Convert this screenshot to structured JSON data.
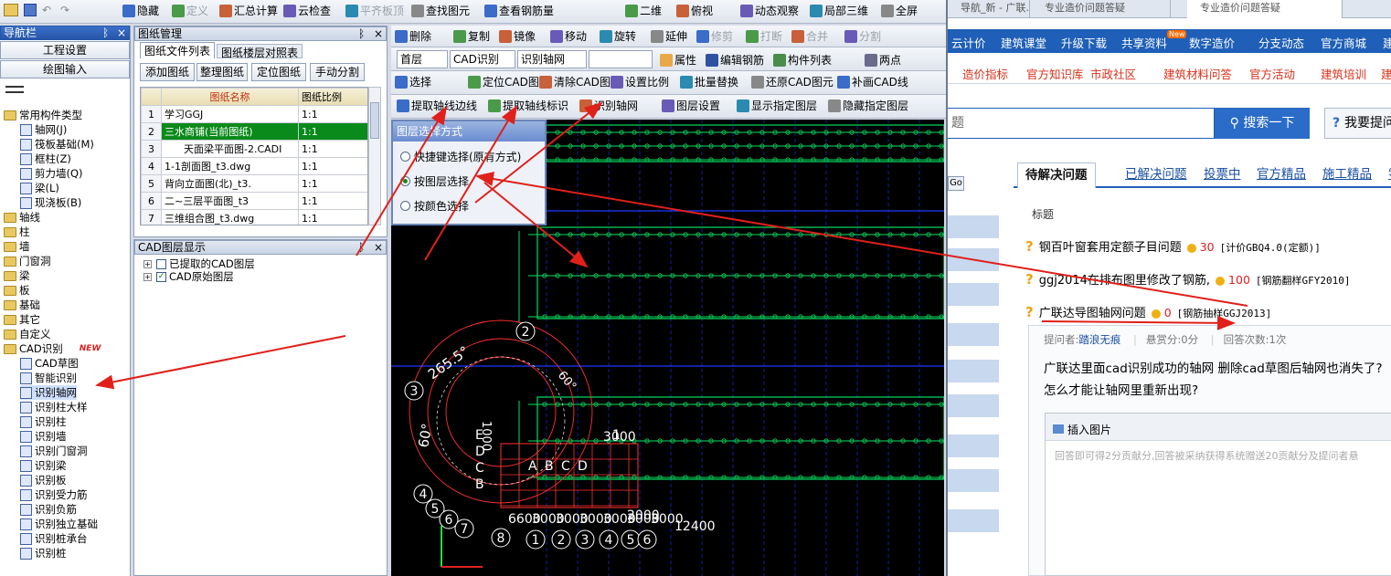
{
  "nav": {
    "title": "导航栏",
    "pin": "ᛒ",
    "close": "×",
    "btn_project": "工程设置",
    "btn_draw": "绘图输入",
    "tree": [
      {
        "label": "常用构件类型",
        "level": 0,
        "kind": "folder"
      },
      {
        "label": "轴网(J)",
        "level": 1,
        "kind": "item"
      },
      {
        "label": "筏板基础(M)",
        "level": 1,
        "kind": "item"
      },
      {
        "label": "框柱(Z)",
        "level": 1,
        "kind": "item"
      },
      {
        "label": "剪力墙(Q)",
        "level": 1,
        "kind": "item"
      },
      {
        "label": "梁(L)",
        "level": 1,
        "kind": "item"
      },
      {
        "label": "现浇板(B)",
        "level": 1,
        "kind": "item"
      },
      {
        "label": "轴线",
        "level": 0,
        "kind": "folder"
      },
      {
        "label": "柱",
        "level": 0,
        "kind": "folder"
      },
      {
        "label": "墙",
        "level": 0,
        "kind": "folder"
      },
      {
        "label": "门窗洞",
        "level": 0,
        "kind": "folder"
      },
      {
        "label": "梁",
        "level": 0,
        "kind": "folder"
      },
      {
        "label": "板",
        "level": 0,
        "kind": "folder"
      },
      {
        "label": "基础",
        "level": 0,
        "kind": "folder"
      },
      {
        "label": "其它",
        "level": 0,
        "kind": "folder"
      },
      {
        "label": "自定义",
        "level": 0,
        "kind": "folder"
      },
      {
        "label": "CAD识别",
        "level": 0,
        "kind": "folder",
        "badge": "NEW"
      },
      {
        "label": "CAD草图",
        "level": 1,
        "kind": "item"
      },
      {
        "label": "智能识别",
        "level": 1,
        "kind": "item"
      },
      {
        "label": "识别轴网",
        "level": 1,
        "kind": "item",
        "selected": true
      },
      {
        "label": "识别柱大样",
        "level": 1,
        "kind": "item"
      },
      {
        "label": "识别柱",
        "level": 1,
        "kind": "item"
      },
      {
        "label": "识别墙",
        "level": 1,
        "kind": "item"
      },
      {
        "label": "识别门窗洞",
        "level": 1,
        "kind": "item"
      },
      {
        "label": "识别梁",
        "level": 1,
        "kind": "item"
      },
      {
        "label": "识别板",
        "level": 1,
        "kind": "item"
      },
      {
        "label": "识别受力筋",
        "level": 1,
        "kind": "item"
      },
      {
        "label": "识别负筋",
        "level": 1,
        "kind": "item"
      },
      {
        "label": "识别独立基础",
        "level": 1,
        "kind": "item"
      },
      {
        "label": "识别桩承台",
        "level": 1,
        "kind": "item"
      },
      {
        "label": "识别桩",
        "level": 1,
        "kind": "item"
      }
    ]
  },
  "toolbar1": [
    "隐藏",
    "定义",
    "汇总计算",
    "云检查",
    "平齐板顶",
    "查找图元",
    "查看钢筋量",
    "二维",
    "俯视",
    "动态观察",
    "局部三维",
    "全屏"
  ],
  "toolbar2": [
    "删除",
    "复制",
    "镜像",
    "移动",
    "旋转",
    "延伸",
    "修剪",
    "打断",
    "合并",
    "分割"
  ],
  "toolbar3": {
    "floor": "首层",
    "cad": "CAD识别",
    "axis": "识别轴网",
    "blank": "",
    "attr": "属性",
    "edit": "编辑钢筋",
    "list": "构件列表",
    "two": "两点"
  },
  "toolbar4": [
    "选择",
    "定位CAD图",
    "清除CAD图",
    "设置比例",
    "批量替换",
    "还原CAD图元",
    "补画CAD线"
  ],
  "toolbar5": [
    "提取轴线边线",
    "提取轴线标识",
    "识别轴网",
    "图层设置",
    "显示指定图层",
    "隐藏指定图层"
  ],
  "drawing_mgr": {
    "title": "图纸管理",
    "tab1": "图纸文件列表",
    "tab2": "图纸楼层对照表",
    "btns": [
      "添加图纸",
      "整理图纸",
      "定位图纸",
      "手动分割"
    ],
    "col_name": "图纸名称",
    "col_ratio": "图纸比例",
    "rows": [
      [
        "1",
        "学习GGJ",
        "1:1"
      ],
      [
        "2",
        "三水商铺(当前图纸)",
        "1:1"
      ],
      [
        "3",
        "天面梁平面图-2.CADI",
        "1:1"
      ],
      [
        "4",
        "1-1剖面图_t3.dwg",
        "1:1"
      ],
      [
        "5",
        "背向立面图(北)_t3.",
        "1:1"
      ],
      [
        "6",
        "二~三层平面图_t3",
        "1:1"
      ],
      [
        "7",
        "三维组合图_t3.dwg",
        "1:1"
      ]
    ]
  },
  "cad_layer": {
    "title": "CAD图层显示",
    "items": [
      "已提取的CAD图层",
      "CAD原始图层"
    ]
  },
  "layer_dialog": {
    "title": "图层选择方式",
    "options": [
      "快捷键选择(原有方式)",
      "按图层选择",
      "按颜色选择"
    ],
    "selected": 1
  },
  "cad_labels": {
    "angle1": "265.5°",
    "angle2": "60°",
    "angle3": "60°",
    "dims": [
      "6600",
      "3000",
      "3000",
      "3000",
      "3000",
      "3000",
      "3000",
      "12400"
    ],
    "letters": [
      "A",
      "B",
      "C",
      "D"
    ],
    "letters_v": [
      "E",
      "D",
      "C",
      "B"
    ],
    "nums": [
      "2",
      "3",
      "4",
      "5",
      "6",
      "7",
      "8",
      "1",
      "2",
      "3",
      "4",
      "5",
      "6",
      "7"
    ],
    "misc": [
      "1000",
      "2000",
      "3000",
      "1"
    ]
  },
  "browser": {
    "tabs": [
      "导航_新 - 广联...",
      "专业造价问题答疑",
      "专业造价问题答疑"
    ],
    "nav": [
      "云计价",
      "建筑课堂",
      "升级下载",
      "共享资料",
      "数字造价",
      "分支动态",
      "官方商城",
      "建筑"
    ],
    "nav_badge": "New",
    "subnav": [
      "造价指标",
      "官方知识库",
      "市政社区",
      "建筑材料问答",
      "官方活动",
      "建筑培训",
      "建"
    ],
    "search_placeholder": "题",
    "search_btn": "搜索一下",
    "ask_btn": "我要提问",
    "go": "Go",
    "qtabs": [
      "待解决问题",
      "已解决问题",
      "投票中",
      "官方精品",
      "施工精品",
      "零"
    ],
    "col_title": "标题",
    "questions": [
      {
        "title": "钢百叶窗套用定额子目问题",
        "score": "30",
        "tag": "[计价GBQ4.0(定额)]"
      },
      {
        "title": "ggj2014在排布图里修改了钢筋,",
        "score": "100",
        "tag": "[钢筋翻样GFY2010]"
      },
      {
        "title": "广联达导图轴网问题",
        "score": "0",
        "tag": "[钢筋抽样GGJ2013]"
      }
    ],
    "meta": {
      "asker_label": "提问者:",
      "asker": "踏浪无痕",
      "reward": "悬赏分:0分",
      "answers": "回答次数:1次"
    },
    "body": [
      "广联达里面cad识别成功的轴网 删除cad草图后轴网也消失了?",
      "怎么才能让轴网里重新出现?"
    ],
    "insert_img": "插入图片",
    "reply_placeholder": "回答即可得2分贡献分,回答被采纳获得系统赠送20贡献分及提问者悬"
  },
  "colors": {
    "accent": "#1a4fa0",
    "red": "#e0201a",
    "cad_bg": "#000000",
    "cad_line": "#00e060",
    "cad_grid": "#1c38ff",
    "selected_row": "#0a8a1a"
  }
}
